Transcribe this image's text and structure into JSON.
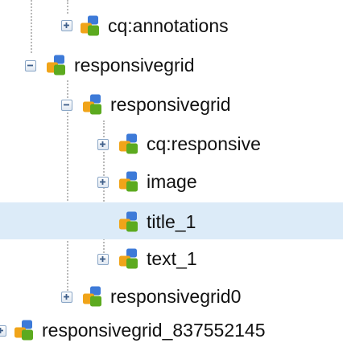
{
  "tree": {
    "nodes": [
      {
        "label": "cq:annotations",
        "state": "collapsed",
        "icon": "node-icon"
      },
      {
        "label": "responsivegrid",
        "state": "expanded",
        "icon": "node-icon"
      },
      {
        "label": "responsivegrid",
        "state": "expanded",
        "icon": "node-icon"
      },
      {
        "label": "cq:responsive",
        "state": "collapsed",
        "icon": "node-icon"
      },
      {
        "label": "image",
        "state": "collapsed",
        "icon": "node-icon"
      },
      {
        "label": "title_1",
        "state": "leaf",
        "selected": true,
        "icon": "node-icon"
      },
      {
        "label": "text_1",
        "state": "collapsed",
        "icon": "node-icon"
      },
      {
        "label": "responsivegrid0",
        "state": "collapsed",
        "icon": "node-icon"
      },
      {
        "label": "responsivegrid_837552145",
        "state": "collapsed",
        "icon": "node-icon"
      }
    ]
  },
  "colors": {
    "selection": "#dcebf8",
    "connector": "#b9b9b9",
    "toggle_border": "#8aa6c6",
    "icon_blue": "#3d7ad8",
    "icon_green": "#5caa1f",
    "icon_orange": "#f0a419"
  }
}
